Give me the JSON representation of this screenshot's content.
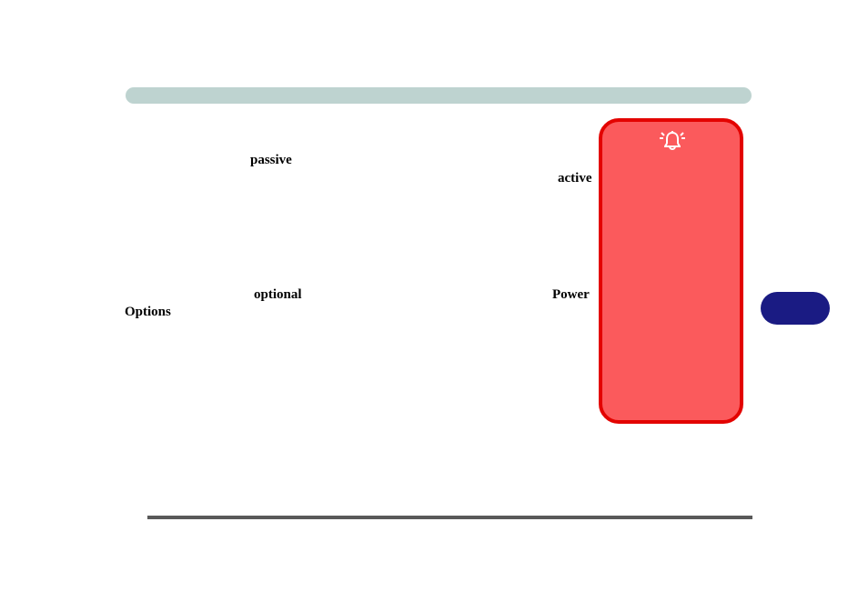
{
  "labels": {
    "passive": "passive",
    "active": "active",
    "optional": "optional",
    "power": "Power",
    "options": "Options"
  },
  "icons": {
    "bell": "bell-icon"
  },
  "colors": {
    "topBar": "#bed3d0",
    "redPanelFill": "#fb5a5c",
    "redPanelBorder": "#e30300",
    "pill": "#1a1b83",
    "bottomLine": "#595959"
  }
}
